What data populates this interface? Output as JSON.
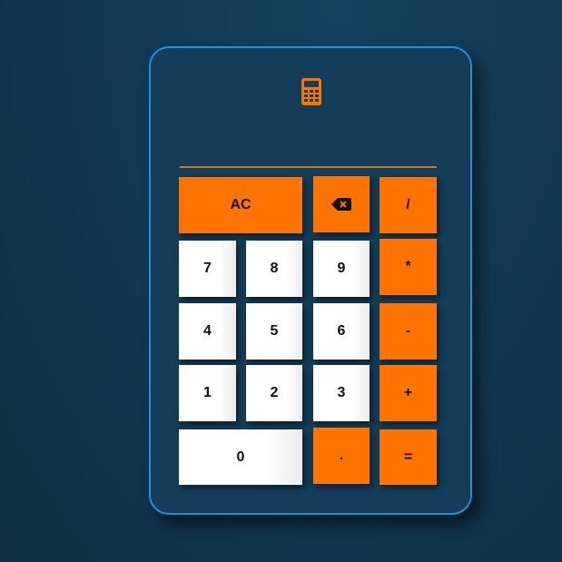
{
  "display": {
    "value": ""
  },
  "icons": {
    "calculator": "calculator-icon",
    "backspace": "backspace-icon"
  },
  "colors": {
    "accent": "#ff7400",
    "border": "#1e90e0",
    "panel": "#133d58",
    "key": "#ffffff"
  },
  "keys": {
    "ac": "AC",
    "divide": "/",
    "seven": "7",
    "eight": "8",
    "nine": "9",
    "multiply": "*",
    "four": "4",
    "five": "5",
    "six": "6",
    "minus": "-",
    "one": "1",
    "two": "2",
    "three": "3",
    "plus": "+",
    "zero": "0",
    "dot": ".",
    "equals": "="
  }
}
